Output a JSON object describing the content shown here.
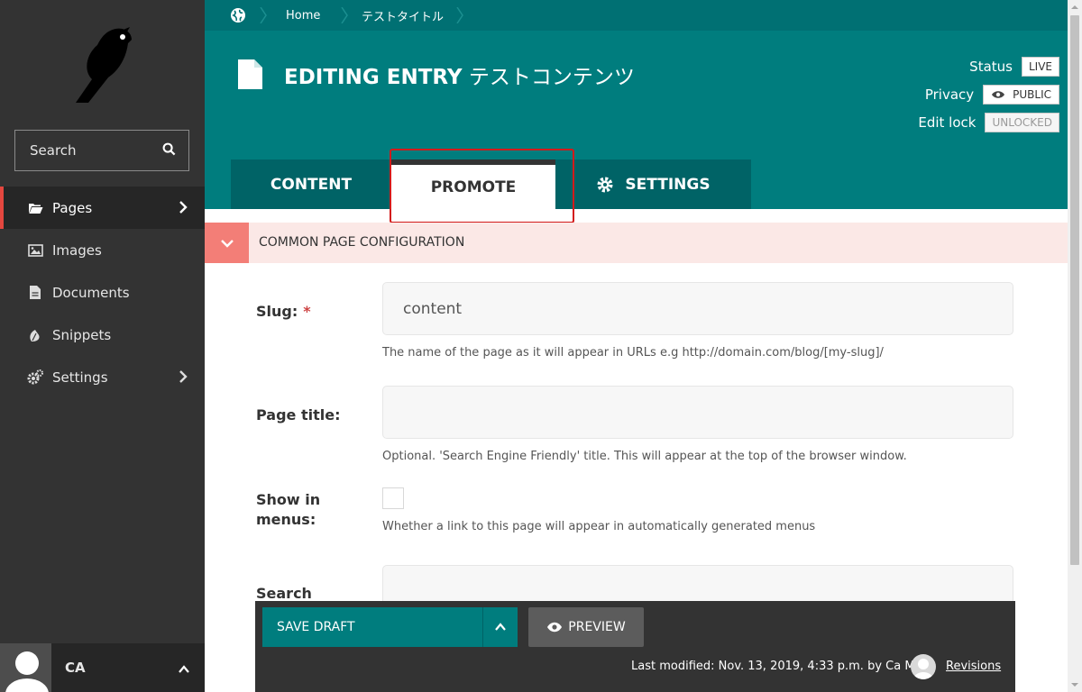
{
  "sidebar": {
    "search_label": "Search",
    "items": [
      {
        "label": "Pages",
        "icon": "folder-open-icon",
        "active": true,
        "has_submenu": true
      },
      {
        "label": "Images",
        "icon": "image-icon",
        "active": false,
        "has_submenu": false
      },
      {
        "label": "Documents",
        "icon": "document-icon",
        "active": false,
        "has_submenu": false
      },
      {
        "label": "Snippets",
        "icon": "snippet-icon",
        "active": false,
        "has_submenu": false
      },
      {
        "label": "Settings",
        "icon": "cogs-icon",
        "active": false,
        "has_submenu": true
      }
    ],
    "account": {
      "initials": "CA"
    }
  },
  "breadcrumb": [
    {
      "label": "Home"
    },
    {
      "label": "テストタイトル"
    }
  ],
  "header": {
    "title_label": "EDITING ENTRY",
    "title_value": "テストコンテンツ",
    "status_label": "Status",
    "status_value": "LIVE",
    "privacy_label": "Privacy",
    "privacy_value": "PUBLIC",
    "lock_label": "Edit lock",
    "lock_value": "UNLOCKED"
  },
  "tabs": [
    {
      "label": "CONTENT",
      "active": false
    },
    {
      "label": "PROMOTE",
      "active": true
    },
    {
      "label": "SETTINGS",
      "active": false
    }
  ],
  "section": {
    "title": "COMMON PAGE CONFIGURATION"
  },
  "fields": {
    "slug": {
      "label": "Slug:",
      "required_mark": "*",
      "value": "content",
      "help": "The name of the page as it will appear in URLs e.g http://domain.com/blog/[my-slug]/"
    },
    "page_title": {
      "label": "Page title:",
      "value": "",
      "help": "Optional. 'Search Engine Friendly' title. This will appear at the top of the browser window."
    },
    "show_in_menus": {
      "label_line1": "Show in",
      "label_line2": "menus:",
      "checked": false,
      "help": "Whether a link to this page will appear in automatically generated menus"
    },
    "search": {
      "label": "Search"
    }
  },
  "footer": {
    "save_label": "SAVE DRAFT",
    "preview_label": "PREVIEW",
    "last_modified": "Last modified: Nov. 13, 2019, 4:33 p.m. by Ca Mity",
    "revisions_label": "Revisions"
  },
  "colors": {
    "header_teal": "#007d7e",
    "tab_dark": "#006366",
    "sidebar_bg": "#333333",
    "accent_red": "#e4473f",
    "section_bg": "#fbe8e6",
    "section_toggle": "#f37e77"
  }
}
